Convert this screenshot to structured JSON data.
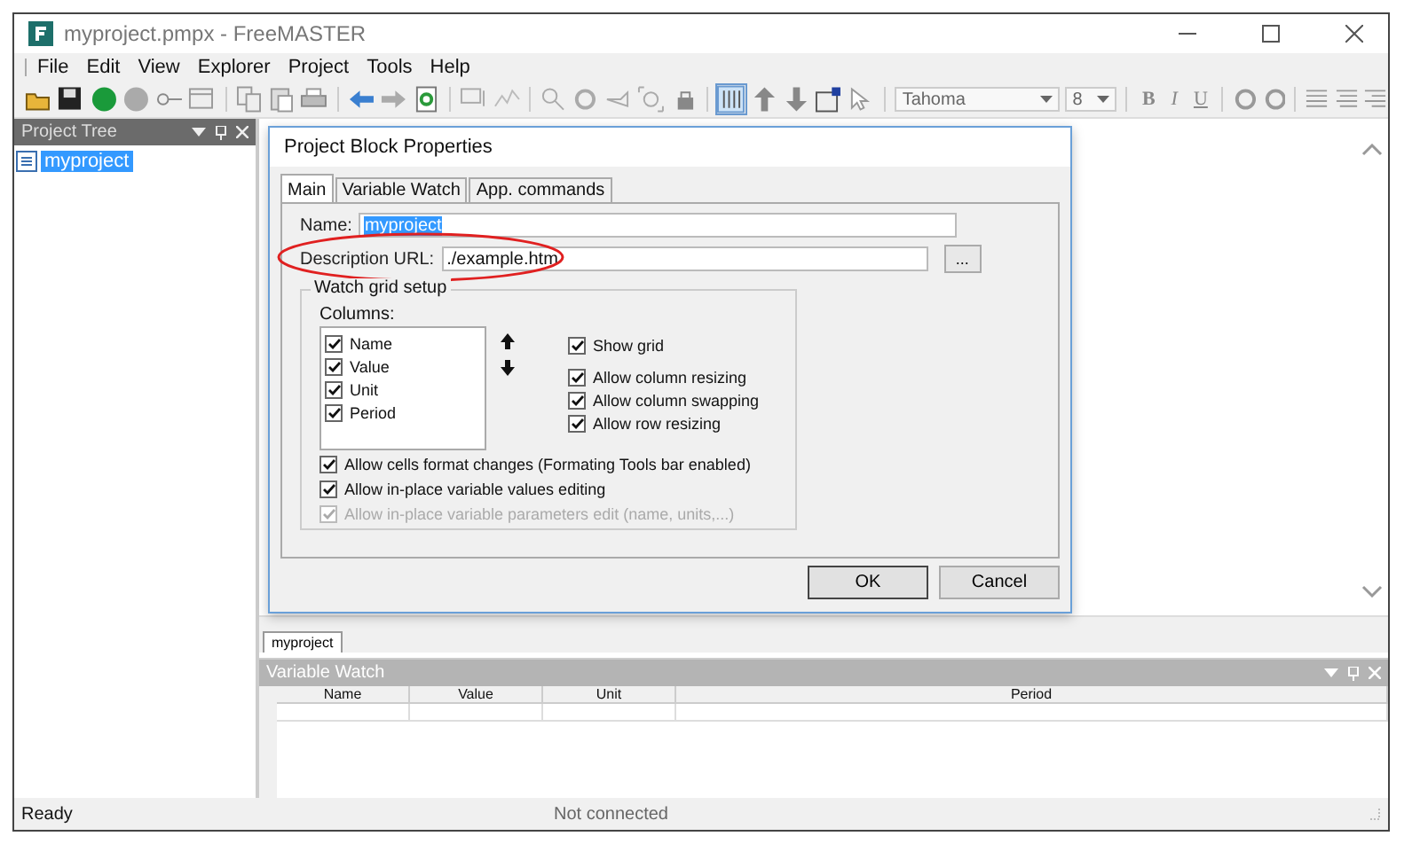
{
  "window": {
    "title": "myproject.pmpx - FreeMASTER"
  },
  "menu": [
    {
      "label": "File"
    },
    {
      "label": "Edit"
    },
    {
      "label": "View"
    },
    {
      "label": "Explorer"
    },
    {
      "label": "Project"
    },
    {
      "label": "Tools"
    },
    {
      "label": "Help"
    }
  ],
  "toolbar": {
    "font_field": {
      "value": "Tahoma"
    },
    "size_field": {
      "value": "8"
    },
    "format_buttons": [
      {
        "label": "B",
        "kind": "bold"
      },
      {
        "label": "I",
        "kind": "italic"
      },
      {
        "label": "U",
        "kind": "underline"
      }
    ]
  },
  "project_tree": {
    "title": "Project Tree",
    "items": [
      {
        "label": "myproject",
        "selected": true
      }
    ]
  },
  "dialog": {
    "title": "Project Block Properties",
    "tabs": [
      {
        "label": "Main",
        "selected": true
      },
      {
        "label": "Variable Watch",
        "selected": false
      },
      {
        "label": "App. commands",
        "selected": false
      }
    ],
    "name_field": {
      "label": "Name:",
      "value": "myproject",
      "value_selected": true
    },
    "url_field": {
      "label": "Description URL:",
      "value": "./example.htm",
      "annotated": true
    },
    "browse_button": "...",
    "group": {
      "title": "Watch grid setup",
      "columns_label": "Columns:",
      "columns": [
        {
          "label": "Name",
          "checked": true
        },
        {
          "label": "Value",
          "checked": true
        },
        {
          "label": "Unit",
          "checked": true
        },
        {
          "label": "Period",
          "checked": true
        }
      ],
      "grid_options": [
        {
          "label": "Show grid",
          "checked": true
        },
        {
          "label": "Allow column resizing",
          "checked": true
        },
        {
          "label": "Allow column swapping",
          "checked": true
        },
        {
          "label": "Allow row resizing",
          "checked": true
        }
      ],
      "edit_options": [
        {
          "label": "Allow cells format changes (Formating Tools bar enabled)",
          "checked": true,
          "disabled": false
        },
        {
          "label": "Allow in-place variable values editing",
          "checked": true,
          "disabled": false
        },
        {
          "label": "Allow in-place variable parameters edit (name, units,...)",
          "checked": true,
          "disabled": true
        }
      ]
    },
    "buttons": [
      {
        "label": "OK",
        "default": true
      },
      {
        "label": "Cancel",
        "default": false
      }
    ]
  },
  "document_tabs": [
    {
      "label": "myproject",
      "selected": true
    }
  ],
  "variable_watch": {
    "title": "Variable Watch",
    "columns": [
      "Name",
      "Value",
      "Unit",
      "Period"
    ]
  },
  "status_bar": [
    "Ready",
    "Not connected"
  ]
}
